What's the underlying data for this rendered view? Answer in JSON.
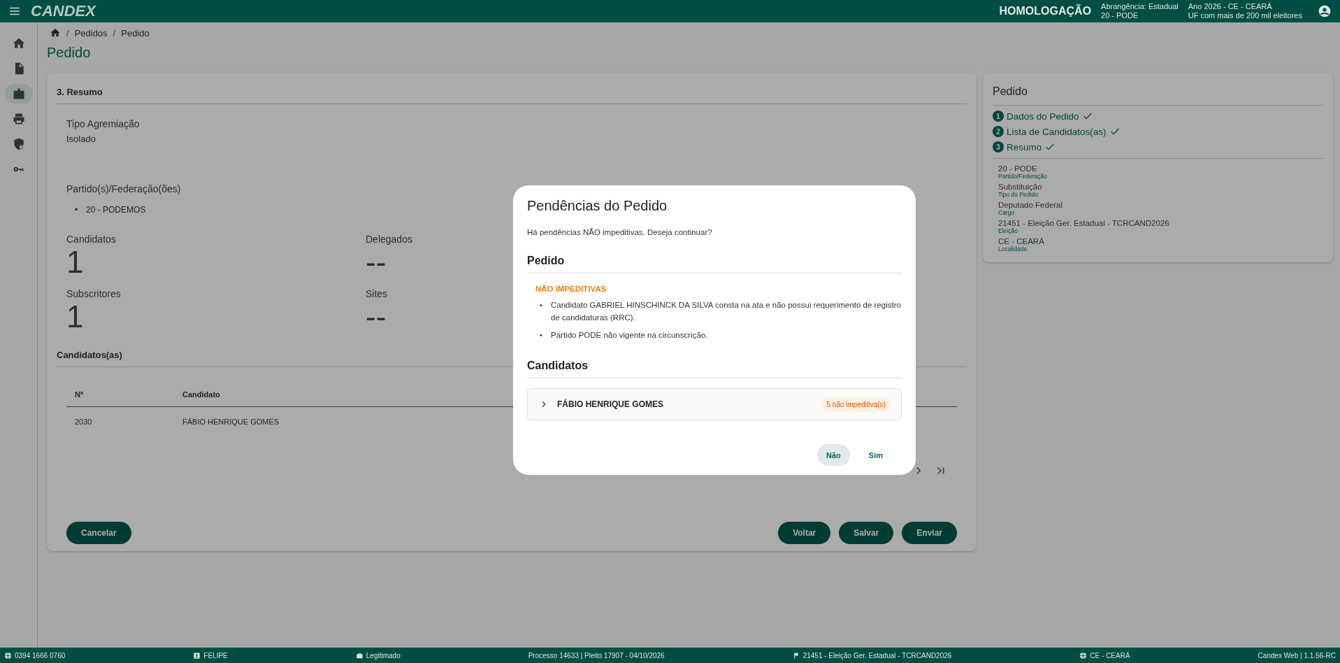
{
  "top_bar": {
    "logo": "CANDEX",
    "environment": "HOMOLOGAÇÃO",
    "scope": [
      "Abrangência: Estadual",
      "20 - PODE"
    ],
    "context": [
      "Ano 2026 - CE - CEARÁ",
      "UF com mais de 200 mil eleitores"
    ]
  },
  "sidebar": {
    "items": [
      {
        "kind": "home",
        "selected": false
      },
      {
        "kind": "document",
        "selected": false
      },
      {
        "kind": "badge",
        "selected": true
      },
      {
        "kind": "printer",
        "selected": false
      },
      {
        "kind": "shield",
        "selected": false
      },
      {
        "kind": "key",
        "selected": false
      }
    ]
  },
  "breadcrumb": [
    {
      "separator": "/",
      "label": "Pedidos"
    },
    {
      "separator": "/",
      "label": "Pedido"
    }
  ],
  "page_title": "Pedido",
  "summary": {
    "title": "3. Resumo",
    "type_label": "Tipo Agremiação",
    "type_value": "Isolado",
    "parties_label": "Partido(s)/Federação(ões)",
    "parties": [
      {
        "bullet": "•",
        "text": "20 - PODEMOS"
      }
    ],
    "stats": [
      {
        "label": "Candidatos",
        "value": "1"
      },
      {
        "label": "Delegados",
        "value": "--"
      },
      {
        "label": "Subscritores",
        "value": "1"
      },
      {
        "label": "Sites",
        "value": "--"
      }
    ],
    "candidates_title": "Candidatos(as)",
    "table": {
      "columns": [
        "Nº",
        "Candidato"
      ],
      "rows": [
        [
          "2030",
          "FÁBIO HENRIQUE GOMES"
        ]
      ]
    },
    "left_buttons": [
      "Cancelar"
    ],
    "right_buttons": [
      "Voltar",
      "Salvar",
      "Enviar"
    ]
  },
  "steps_panel": {
    "title": "Pedido",
    "steps": [
      {
        "number": "1",
        "label": "Dados do Pedido",
        "done": true
      },
      {
        "number": "2",
        "label": "Lista de Candidatos(as)",
        "done": true
      },
      {
        "number": "3",
        "label": "Resumo",
        "done": true
      }
    ],
    "details": [
      {
        "value": "20 - PODE",
        "label": "Partido/Federação"
      },
      {
        "value": "Substituição",
        "label": "Tipo do Pedido"
      },
      {
        "value": "Deputado Federal",
        "label": "Cargo"
      },
      {
        "value": "21451 - Eleição Ger. Estadual - TCRCAND2026",
        "label": "Eleição"
      },
      {
        "value": "CE - CEARÁ",
        "label": "Localidade"
      }
    ]
  },
  "dialog": {
    "title": "Pendências do Pedido",
    "message": "Há pendências NÃO impeditivas. Deseja continuar?",
    "order_heading": "Pedido",
    "issues_heading": "NÃO IMPEDITIVAS",
    "issues": [
      {
        "bullet": "•",
        "text": "Candidato GABRIEL HINSCHINCK DA SILVA consta na ata e não possui requerimento de registro de candidaturas (RRC)."
      },
      {
        "bullet": "•",
        "text": "Partido PODE não vigente na circunscrição."
      }
    ],
    "candidates_heading": "Candidatos",
    "candidates": [
      {
        "name": "FÁBIO HENRIQUE GOMES",
        "badge": "5 não impeditiva(s)",
        "expanded": false
      }
    ],
    "buttons": [
      {
        "label": "Não",
        "kind": "tonal"
      },
      {
        "label": "Sim",
        "kind": "text"
      }
    ]
  },
  "status_bar": [
    {
      "kind": "globe",
      "text": "0394 1666 0760"
    },
    {
      "kind": "person",
      "text": "FELIPE"
    },
    {
      "kind": "case",
      "text": "Legitimado"
    },
    {
      "kind": "none",
      "text": "Processo 14633 | Pleito 17907 - 04/10/2026"
    },
    {
      "kind": "flag",
      "text": "21451 - Eleição Ger. Estadual - TCRCAND2026"
    },
    {
      "kind": "globe",
      "text": "CE - CEARÁ"
    },
    {
      "kind": "none",
      "text": "Candex Web | 1.1.56-RC"
    }
  ]
}
